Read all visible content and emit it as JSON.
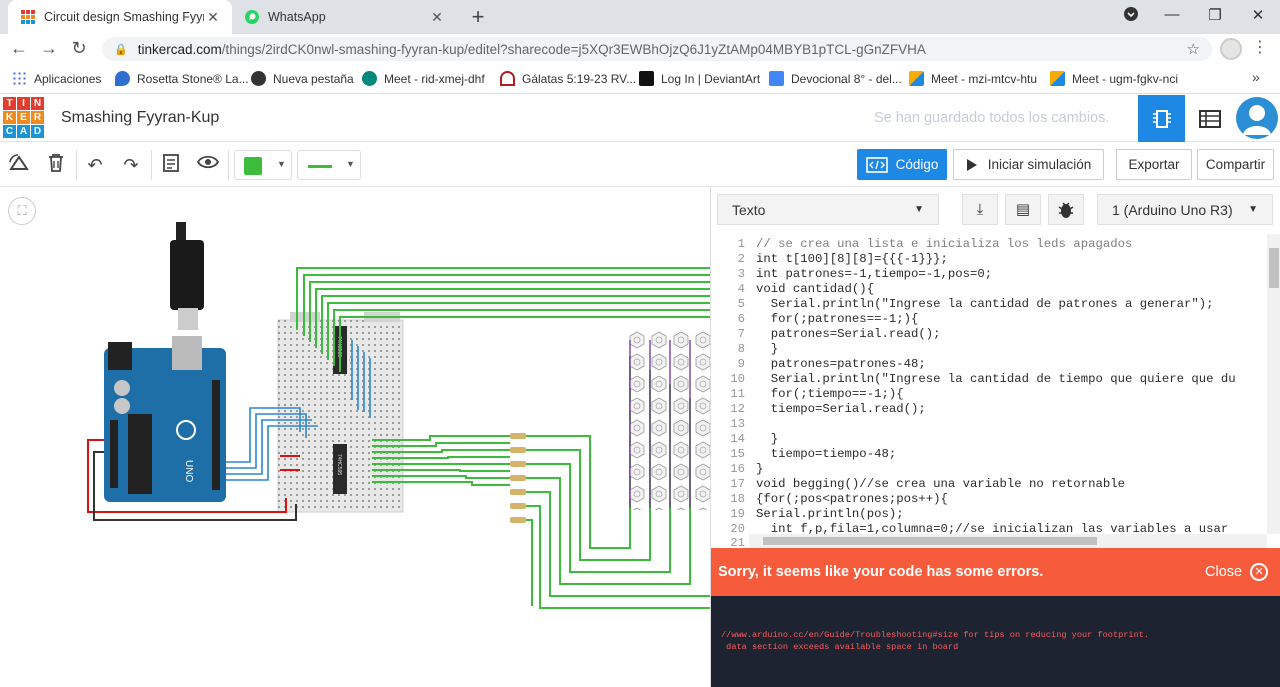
{
  "browser": {
    "tabs": [
      {
        "title": "Circuit design Smashing Fyyran-K",
        "active": true,
        "close": "✕"
      },
      {
        "title": "WhatsApp",
        "active": false,
        "close": "✕"
      }
    ],
    "new_tab": "+",
    "url_host": "tinkercad.com",
    "url_path": "/things/2irdCK0nwl-smashing-fyyran-kup/editel?sharecode=j5XQr3EWBhOjzQ6J1yZtAMp04MBYB1pTCL-gGnZFVHA",
    "bookmarks": [
      {
        "label": "Aplicaciones",
        "icon": "apps-grid-icon",
        "color": "#4a6bd6"
      },
      {
        "label": "Rosetta Stone® La...",
        "icon": "rosetta-icon",
        "color": "#2f6fd1"
      },
      {
        "label": "Nueva pestaña",
        "icon": "globe-icon",
        "color": "#333333"
      },
      {
        "label": "Meet - rid-xmej-dhf",
        "icon": "meet-icon",
        "color": "#00897b"
      },
      {
        "label": "Gálatas 5:19-23 RV...",
        "icon": "bible-icon",
        "color": "#b71c1c"
      },
      {
        "label": "Log In | DeviantArt",
        "icon": "deviantart-icon",
        "color": "#05cc47"
      },
      {
        "label": "Devocional 8° - del...",
        "icon": "docs-icon",
        "color": "#4285f4"
      },
      {
        "label": "Meet - mzi-mtcv-htu",
        "icon": "meet-icon",
        "color": "#f9ab00"
      },
      {
        "label": "Meet - ugm-fgkv-nci",
        "icon": "meet-icon",
        "color": "#f9ab00"
      }
    ],
    "bookmarks_more": "»"
  },
  "tinkercad": {
    "logo_letters": [
      "T",
      "I",
      "N",
      "K",
      "E",
      "R",
      "C",
      "A",
      "D"
    ],
    "logo_colors": [
      "#e23c2e",
      "#e23c2e",
      "#e23c2e",
      "#f08b22",
      "#f08b22",
      "#f08b22",
      "#1a96d4",
      "#1a96d4",
      "#1a96d4"
    ],
    "project_name": "Smashing Fyyran-Kup",
    "save_status": "Se han guardado todos los cambios.",
    "accent": "#1e88e5"
  },
  "toolbar": {
    "code_label": "Código",
    "simulate_label": "Iniciar simulación",
    "export_label": "Exportar",
    "share_label": "Compartir",
    "wire_color": "#3dbb3d"
  },
  "code_panel": {
    "mode": "Texto",
    "device": "1 (Arduino Uno R3)",
    "lines": [
      {
        "n": "1",
        "text": "// se crea una lista e inicializa los leds apagados"
      },
      {
        "n": "2",
        "text": "int t[100][8][8]={{{-1}}};"
      },
      {
        "n": "3",
        "text": "int patrones=-1,tiempo=-1,pos=0;"
      },
      {
        "n": "4",
        "text": "void cantidad(){"
      },
      {
        "n": "5",
        "text": "  Serial.println(\"Ingrese la cantidad de patrones a generar\");"
      },
      {
        "n": "6",
        "text": "  for(;patrones==-1;){"
      },
      {
        "n": "7",
        "text": "  patrones=Serial.read();"
      },
      {
        "n": "8",
        "text": "  }"
      },
      {
        "n": "9",
        "text": "  patrones=patrones-48;"
      },
      {
        "n": "10",
        "text": "  Serial.println(\"Ingrese la cantidad de tiempo que quiere que du"
      },
      {
        "n": "11",
        "text": "  for(;tiempo==-1;){"
      },
      {
        "n": "12",
        "text": "  tiempo=Serial.read();"
      },
      {
        "n": "13",
        "text": ""
      },
      {
        "n": "14",
        "text": "  }"
      },
      {
        "n": "15",
        "text": "  tiempo=tiempo-48;"
      },
      {
        "n": "16",
        "text": "}"
      },
      {
        "n": "17",
        "text": "void begging()//se crea una variable no retornable"
      },
      {
        "n": "18",
        "text": "{for(;pos<patrones;pos++){"
      },
      {
        "n": "19",
        "text": "Serial.println(pos);"
      },
      {
        "n": "20",
        "text": "  int f,p,fila=1,columna=0;//se inicializan las variables a usar"
      },
      {
        "n": "21",
        "text": ""
      }
    ],
    "error_message": "Sorry, it seems like your code has some errors.",
    "close_label": "Close",
    "console_lines": [
      "//www.arduino.cc/en/Guide/Troubleshooting#size for tips on reducing your footprint.",
      " data section exceeds available space in board"
    ]
  },
  "circuit": {
    "ic_label_top": "74HC595",
    "ic_label_bottom": "74HC595"
  }
}
